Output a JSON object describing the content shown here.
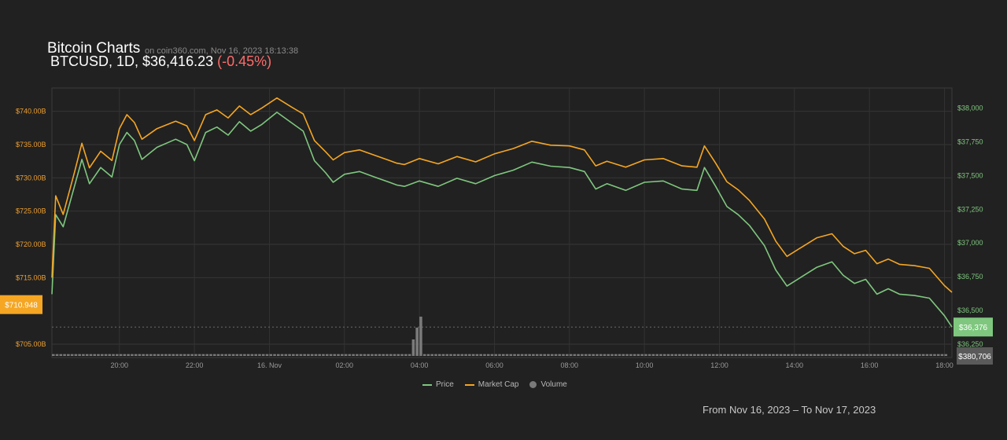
{
  "header": {
    "title": "Bitcoin Charts",
    "source": "on coin360.com, Nov 16, 2023 18:13:38",
    "pair_line": "BTCUSD, 1D, $36,416.23",
    "change": "(-0.45%)"
  },
  "footer": {
    "range": "From Nov 16, 2023 – To Nov 17, 2023"
  },
  "colors": {
    "price": "#7fc77f",
    "market_cap": "#f5a623",
    "volume": "#7a7a7a",
    "change_negative": "#ff6b6b",
    "background": "#212121"
  },
  "chart_data": {
    "type": "line",
    "x_ticks": [
      "20:00",
      "22:00",
      "16. Nov",
      "02:00",
      "04:00",
      "06:00",
      "08:00",
      "10:00",
      "12:00",
      "14:00",
      "16:00",
      "18:00"
    ],
    "x_tick_hours": [
      20,
      22,
      24,
      26,
      28,
      30,
      32,
      34,
      36,
      38,
      40,
      42
    ],
    "x_range": [
      18.2,
      42.2
    ],
    "left_axis": {
      "label": "Market Cap",
      "ticks": [
        "$740.00B",
        "$735.00B",
        "$730.00B",
        "$725.00B",
        "$720.00B",
        "$715.00B",
        "$705.00B"
      ],
      "tick_values": [
        740,
        735,
        730,
        725,
        720,
        715,
        705
      ],
      "range": [
        703,
        743.5
      ],
      "current_label": "$710.948",
      "current_value": 710.948
    },
    "right_axis": {
      "label": "Price",
      "ticks": [
        "$38,000",
        "$37,750",
        "$37,500",
        "$37,250",
        "$37,000",
        "$36,750",
        "$36,500",
        "$36,250"
      ],
      "tick_values": [
        38000,
        37750,
        37500,
        37250,
        37000,
        36750,
        36500,
        36250
      ],
      "range": [
        36150,
        38150
      ],
      "current_label": "$36,376",
      "current_value": 36376
    },
    "volume_label": "$380,706",
    "series": [
      {
        "name": "Price",
        "x": [
          18.2,
          18.3,
          18.5,
          18.8,
          19.0,
          19.2,
          19.5,
          19.8,
          20.0,
          20.2,
          20.4,
          20.6,
          21.0,
          21.5,
          21.8,
          22.0,
          22.3,
          22.6,
          22.9,
          23.2,
          23.5,
          23.8,
          24.2,
          24.6,
          24.9,
          25.2,
          25.5,
          25.7,
          26.0,
          26.4,
          26.8,
          27.2,
          27.4,
          27.6,
          28.0,
          28.5,
          29.0,
          29.5,
          30.0,
          30.5,
          31.0,
          31.5,
          32.0,
          32.4,
          32.7,
          33.0,
          33.5,
          34.0,
          34.5,
          35.0,
          35.4,
          35.6,
          35.9,
          36.2,
          36.5,
          36.8,
          37.2,
          37.5,
          37.8,
          38.2,
          38.6,
          39.0,
          39.3,
          39.6,
          39.9,
          40.2,
          40.5,
          40.8,
          41.2,
          41.6,
          42.0,
          42.2
        ],
        "values": [
          36620,
          37210,
          37120,
          37420,
          37620,
          37440,
          37560,
          37490,
          37730,
          37820,
          37760,
          37620,
          37710,
          37770,
          37730,
          37610,
          37820,
          37860,
          37800,
          37900,
          37830,
          37880,
          37970,
          37890,
          37830,
          37610,
          37520,
          37450,
          37510,
          37530,
          37490,
          37450,
          37430,
          37420,
          37460,
          37420,
          37480,
          37440,
          37500,
          37540,
          37600,
          37570,
          37560,
          37530,
          37400,
          37440,
          37390,
          37450,
          37460,
          37400,
          37390,
          37560,
          37420,
          37270,
          37210,
          37130,
          36980,
          36800,
          36680,
          36750,
          36820,
          36860,
          36760,
          36700,
          36730,
          36620,
          36660,
          36620,
          36610,
          36590,
          36460,
          36376
        ]
      },
      {
        "name": "Market Cap",
        "x": [
          18.2,
          18.3,
          18.5,
          18.8,
          19.0,
          19.2,
          19.5,
          19.8,
          20.0,
          20.2,
          20.4,
          20.6,
          21.0,
          21.5,
          21.8,
          22.0,
          22.3,
          22.6,
          22.9,
          23.2,
          23.5,
          23.8,
          24.2,
          24.6,
          24.9,
          25.2,
          25.5,
          25.7,
          26.0,
          26.4,
          26.8,
          27.2,
          27.4,
          27.6,
          28.0,
          28.5,
          29.0,
          29.5,
          30.0,
          30.5,
          31.0,
          31.5,
          32.0,
          32.4,
          32.7,
          33.0,
          33.5,
          34.0,
          34.5,
          35.0,
          35.4,
          35.6,
          35.9,
          36.2,
          36.5,
          36.8,
          37.2,
          37.5,
          37.8,
          38.2,
          38.6,
          39.0,
          39.3,
          39.6,
          39.9,
          40.2,
          40.5,
          40.8,
          41.2,
          41.6,
          42.0,
          42.2
        ],
        "values": [
          715.0,
          727.3,
          724.5,
          730.8,
          735.2,
          731.5,
          734.0,
          732.6,
          737.4,
          739.5,
          738.3,
          735.8,
          737.4,
          738.5,
          737.8,
          735.6,
          739.5,
          740.2,
          739.0,
          740.8,
          739.5,
          740.5,
          742.0,
          740.6,
          739.6,
          735.6,
          733.9,
          732.7,
          733.8,
          734.2,
          733.4,
          732.6,
          732.2,
          732.0,
          732.9,
          732.1,
          733.2,
          732.4,
          733.6,
          734.4,
          735.5,
          734.9,
          734.8,
          734.2,
          731.8,
          732.5,
          731.6,
          732.7,
          732.9,
          731.8,
          731.6,
          734.8,
          732.2,
          729.4,
          728.2,
          726.6,
          723.8,
          720.5,
          718.2,
          719.6,
          721.0,
          721.6,
          719.7,
          718.6,
          719.1,
          717.1,
          717.8,
          717.0,
          716.8,
          716.4,
          713.8,
          712.8
        ]
      }
    ],
    "volume": {
      "name": "Volume",
      "spike_hours": [
        27.8,
        27.9,
        28.0
      ],
      "spike_values": [
        0.42,
        0.72,
        1.0
      ],
      "base_value": 0.23
    },
    "legend": [
      "Price",
      "Market Cap",
      "Volume"
    ],
    "legend_position": "bottom-center",
    "grid": true
  }
}
